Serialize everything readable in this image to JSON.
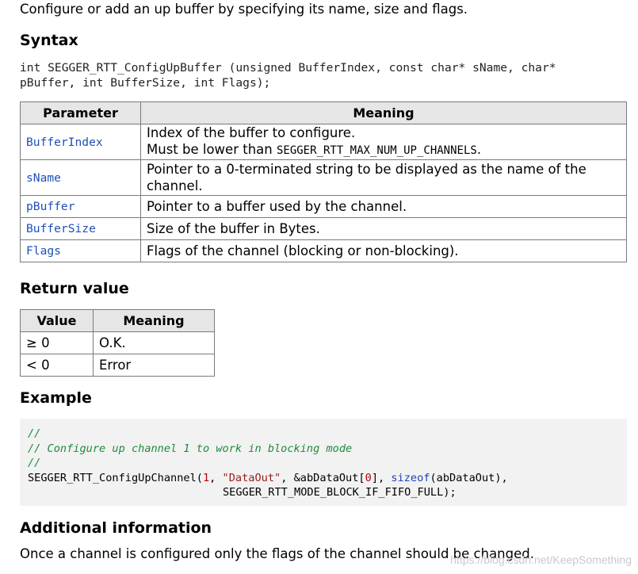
{
  "intro": "Configure or add an up buffer by specifying its name, size and flags.",
  "headings": {
    "syntax": "Syntax",
    "return_value": "Return value",
    "example": "Example",
    "additional_info": "Additional information"
  },
  "syntax": {
    "line1": "int SEGGER_RTT_ConfigUpBuffer (unsigned BufferIndex, const char* sName, char*",
    "line2": "pBuffer, int BufferSize, int Flags);"
  },
  "parameters_table": {
    "headers": [
      "Parameter",
      "Meaning"
    ],
    "rows": [
      {
        "param": "BufferIndex",
        "meaning_line1": "Index of the buffer to configure.",
        "meaning_line2_prefix": "Must be lower than ",
        "meaning_line2_code": "SEGGER_RTT_MAX_NUM_UP_CHANNELS",
        "meaning_line2_suffix": "."
      },
      {
        "param": "sName",
        "meaning": "Pointer to a 0-terminated string to be displayed as the name of the channel."
      },
      {
        "param": "pBuffer",
        "meaning": "Pointer to a buffer used by the channel."
      },
      {
        "param": "BufferSize",
        "meaning": "Size of the buffer in Bytes."
      },
      {
        "param": "Flags",
        "meaning": "Flags of the channel (blocking or non-blocking)."
      }
    ]
  },
  "return_table": {
    "headers": [
      "Value",
      "Meaning"
    ],
    "rows": [
      {
        "value": "≥ 0",
        "meaning": "O.K."
      },
      {
        "value": "< 0",
        "meaning": "Error"
      }
    ]
  },
  "example_code": {
    "comment1": "//",
    "comment2": "// Configure up channel 1 to work in blocking mode",
    "comment3": "//",
    "call_func": "SEGGER_RTT_ConfigUpChannel(",
    "call_num1": "1",
    "call_sep1": ", ",
    "call_str": "\"DataOut\"",
    "call_sep2": ", &abDataOut[",
    "call_num2": "0",
    "call_sep3": "], ",
    "call_kw": "sizeof",
    "call_end": "(abDataOut),",
    "call_line2": "SEGGER_RTT_MODE_BLOCK_IF_FIFO_FULL);"
  },
  "footer": "Once a channel is configured only the flags of the channel should be changed.",
  "watermark": "https://blog.csdn.net/KeepSomething",
  "colors": {
    "param_blue": "#1f4fb5",
    "comment_green": "#1f8a3c",
    "header_gray": "#e6e6e6",
    "code_bg": "#f2f2f2"
  }
}
